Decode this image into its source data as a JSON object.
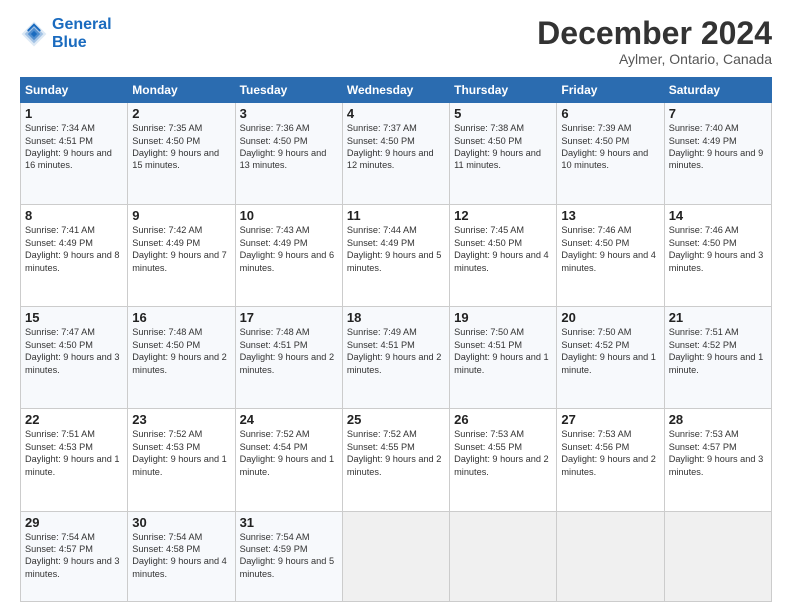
{
  "header": {
    "logo_line1": "General",
    "logo_line2": "Blue",
    "month_title": "December 2024",
    "location": "Aylmer, Ontario, Canada"
  },
  "days_of_week": [
    "Sunday",
    "Monday",
    "Tuesday",
    "Wednesday",
    "Thursday",
    "Friday",
    "Saturday"
  ],
  "weeks": [
    [
      {
        "day": "1",
        "text": "Sunrise: 7:34 AM\nSunset: 4:51 PM\nDaylight: 9 hours and 16 minutes."
      },
      {
        "day": "2",
        "text": "Sunrise: 7:35 AM\nSunset: 4:50 PM\nDaylight: 9 hours and 15 minutes."
      },
      {
        "day": "3",
        "text": "Sunrise: 7:36 AM\nSunset: 4:50 PM\nDaylight: 9 hours and 13 minutes."
      },
      {
        "day": "4",
        "text": "Sunrise: 7:37 AM\nSunset: 4:50 PM\nDaylight: 9 hours and 12 minutes."
      },
      {
        "day": "5",
        "text": "Sunrise: 7:38 AM\nSunset: 4:50 PM\nDaylight: 9 hours and 11 minutes."
      },
      {
        "day": "6",
        "text": "Sunrise: 7:39 AM\nSunset: 4:50 PM\nDaylight: 9 hours and 10 minutes."
      },
      {
        "day": "7",
        "text": "Sunrise: 7:40 AM\nSunset: 4:49 PM\nDaylight: 9 hours and 9 minutes."
      }
    ],
    [
      {
        "day": "8",
        "text": "Sunrise: 7:41 AM\nSunset: 4:49 PM\nDaylight: 9 hours and 8 minutes."
      },
      {
        "day": "9",
        "text": "Sunrise: 7:42 AM\nSunset: 4:49 PM\nDaylight: 9 hours and 7 minutes."
      },
      {
        "day": "10",
        "text": "Sunrise: 7:43 AM\nSunset: 4:49 PM\nDaylight: 9 hours and 6 minutes."
      },
      {
        "day": "11",
        "text": "Sunrise: 7:44 AM\nSunset: 4:49 PM\nDaylight: 9 hours and 5 minutes."
      },
      {
        "day": "12",
        "text": "Sunrise: 7:45 AM\nSunset: 4:50 PM\nDaylight: 9 hours and 4 minutes."
      },
      {
        "day": "13",
        "text": "Sunrise: 7:46 AM\nSunset: 4:50 PM\nDaylight: 9 hours and 4 minutes."
      },
      {
        "day": "14",
        "text": "Sunrise: 7:46 AM\nSunset: 4:50 PM\nDaylight: 9 hours and 3 minutes."
      }
    ],
    [
      {
        "day": "15",
        "text": "Sunrise: 7:47 AM\nSunset: 4:50 PM\nDaylight: 9 hours and 3 minutes."
      },
      {
        "day": "16",
        "text": "Sunrise: 7:48 AM\nSunset: 4:50 PM\nDaylight: 9 hours and 2 minutes."
      },
      {
        "day": "17",
        "text": "Sunrise: 7:48 AM\nSunset: 4:51 PM\nDaylight: 9 hours and 2 minutes."
      },
      {
        "day": "18",
        "text": "Sunrise: 7:49 AM\nSunset: 4:51 PM\nDaylight: 9 hours and 2 minutes."
      },
      {
        "day": "19",
        "text": "Sunrise: 7:50 AM\nSunset: 4:51 PM\nDaylight: 9 hours and 1 minute."
      },
      {
        "day": "20",
        "text": "Sunrise: 7:50 AM\nSunset: 4:52 PM\nDaylight: 9 hours and 1 minute."
      },
      {
        "day": "21",
        "text": "Sunrise: 7:51 AM\nSunset: 4:52 PM\nDaylight: 9 hours and 1 minute."
      }
    ],
    [
      {
        "day": "22",
        "text": "Sunrise: 7:51 AM\nSunset: 4:53 PM\nDaylight: 9 hours and 1 minute."
      },
      {
        "day": "23",
        "text": "Sunrise: 7:52 AM\nSunset: 4:53 PM\nDaylight: 9 hours and 1 minute."
      },
      {
        "day": "24",
        "text": "Sunrise: 7:52 AM\nSunset: 4:54 PM\nDaylight: 9 hours and 1 minute."
      },
      {
        "day": "25",
        "text": "Sunrise: 7:52 AM\nSunset: 4:55 PM\nDaylight: 9 hours and 2 minutes."
      },
      {
        "day": "26",
        "text": "Sunrise: 7:53 AM\nSunset: 4:55 PM\nDaylight: 9 hours and 2 minutes."
      },
      {
        "day": "27",
        "text": "Sunrise: 7:53 AM\nSunset: 4:56 PM\nDaylight: 9 hours and 2 minutes."
      },
      {
        "day": "28",
        "text": "Sunrise: 7:53 AM\nSunset: 4:57 PM\nDaylight: 9 hours and 3 minutes."
      }
    ],
    [
      {
        "day": "29",
        "text": "Sunrise: 7:54 AM\nSunset: 4:57 PM\nDaylight: 9 hours and 3 minutes."
      },
      {
        "day": "30",
        "text": "Sunrise: 7:54 AM\nSunset: 4:58 PM\nDaylight: 9 hours and 4 minutes."
      },
      {
        "day": "31",
        "text": "Sunrise: 7:54 AM\nSunset: 4:59 PM\nDaylight: 9 hours and 5 minutes."
      },
      {
        "day": "",
        "text": ""
      },
      {
        "day": "",
        "text": ""
      },
      {
        "day": "",
        "text": ""
      },
      {
        "day": "",
        "text": ""
      }
    ]
  ]
}
